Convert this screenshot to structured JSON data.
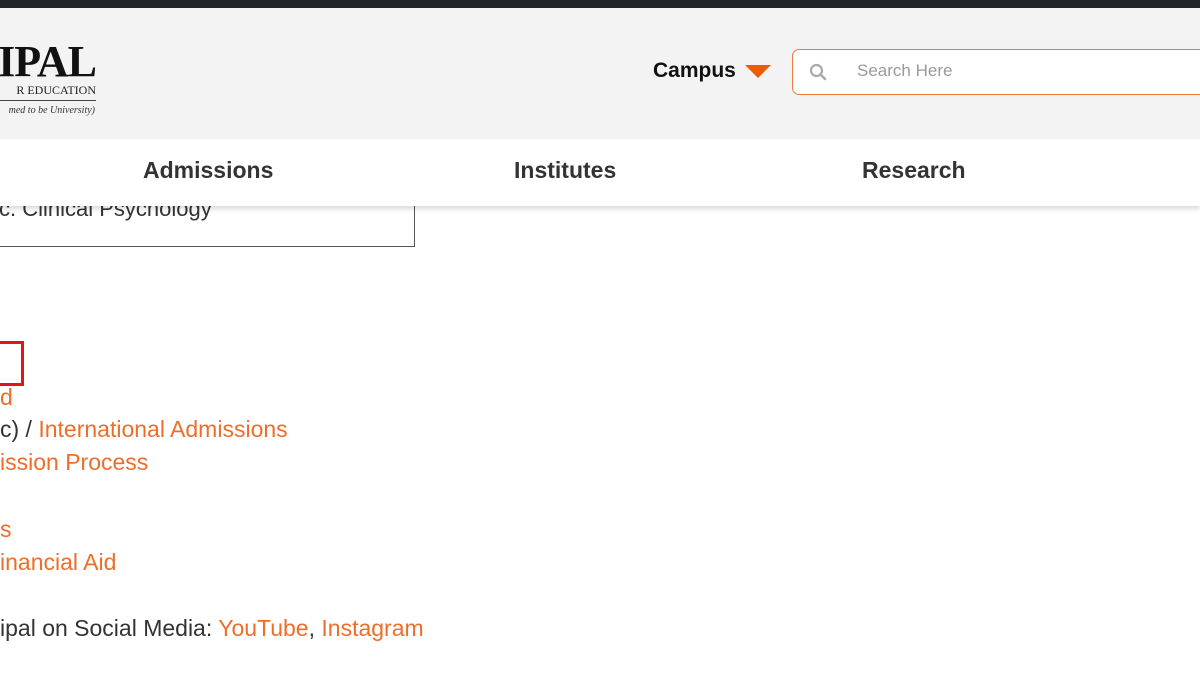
{
  "header": {
    "logo": {
      "main": "IPAL",
      "sub": "R EDUCATION",
      "tag": "med to be University)"
    },
    "campus_label": "Campus",
    "search_placeholder": "Search Here"
  },
  "nav": {
    "items": [
      "Admissions",
      "Institutes",
      "Research"
    ]
  },
  "content": {
    "box_text": "c. Clinical Psychology",
    "line1": "d",
    "line2_prefix": "c) / ",
    "line2_link": "International Admissions",
    "line3": "ission Process",
    "line4": "s",
    "line5": "inancial Aid",
    "line6_prefix": "ipal on Social Media: ",
    "line6_link1": "YouTube",
    "line6_sep": ", ",
    "line6_link2": "Instagram"
  },
  "colors": {
    "accent": "#ef6d2a",
    "highlight": "#e3151b",
    "header_bg": "#f3f3f3"
  }
}
